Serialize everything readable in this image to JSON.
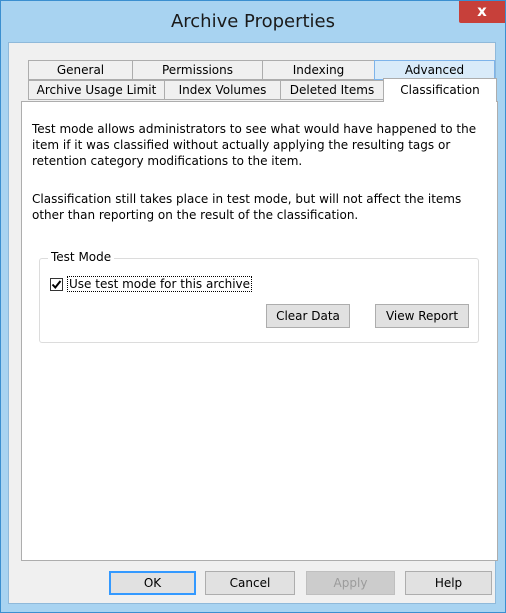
{
  "window": {
    "title": "Archive Properties",
    "close_glyph": "x"
  },
  "tabs_row1": [
    {
      "label": "General"
    },
    {
      "label": "Permissions"
    },
    {
      "label": "Indexing"
    },
    {
      "label": "Advanced"
    }
  ],
  "tabs_row2": [
    {
      "label": "Archive Usage Limit"
    },
    {
      "label": "Index Volumes"
    },
    {
      "label": "Deleted Items"
    },
    {
      "label": "Classification"
    }
  ],
  "content": {
    "para1": "Test mode allows administrators to see what would have happened to the item if it was classified without actually applying the resulting tags or retention category modifications to the item.",
    "para2": "Classification still takes place in test mode, but will not affect the items other than reporting on the result of the classification.",
    "group_title": "Test Mode",
    "checkbox_label": "Use test mode for this archive",
    "checkbox_checked": true,
    "clear_data": "Clear Data",
    "view_report": "View Report"
  },
  "footer": {
    "ok": "OK",
    "cancel": "Cancel",
    "apply": "Apply",
    "help": "Help"
  }
}
